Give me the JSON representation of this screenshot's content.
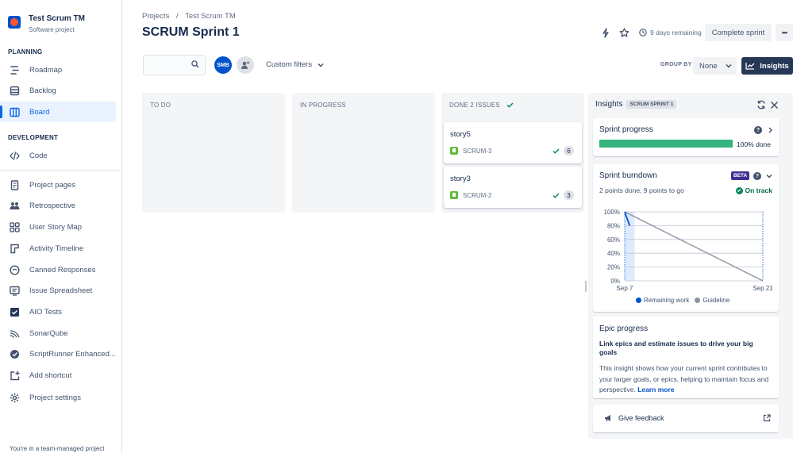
{
  "project": {
    "name": "Test Scrum TM",
    "type": "Software project"
  },
  "sidebar": {
    "planning_title": "PLANNING",
    "development_title": "DEVELOPMENT",
    "planning_items": [
      {
        "label": "Roadmap",
        "icon": "roadmap-icon"
      },
      {
        "label": "Backlog",
        "icon": "backlog-icon"
      },
      {
        "label": "Board",
        "icon": "board-icon",
        "active": true
      }
    ],
    "development_items": [
      {
        "label": "Code",
        "icon": "code-icon"
      }
    ],
    "apps": [
      {
        "label": "Project pages",
        "icon": "pages-icon"
      },
      {
        "label": "Retrospective",
        "icon": "retrospective-icon"
      },
      {
        "label": "User Story Map",
        "icon": "story-map-icon"
      },
      {
        "label": "Activity Timeline",
        "icon": "timeline-icon"
      },
      {
        "label": "Canned Responses",
        "icon": "canned-responses-icon"
      },
      {
        "label": "Issue Spreadsheet",
        "icon": "spreadsheet-icon"
      },
      {
        "label": "AIO Tests",
        "icon": "aio-tests-icon"
      },
      {
        "label": "SonarQube",
        "icon": "sonarqube-icon"
      },
      {
        "label": "ScriptRunner Enhanced...",
        "icon": "scriptrunner-icon"
      },
      {
        "label": "Add shortcut",
        "icon": "add-shortcut-icon"
      },
      {
        "label": "Project settings",
        "icon": "settings-icon"
      }
    ],
    "footer": "You're in a team-managed project"
  },
  "header": {
    "breadcrumb": [
      "Projects",
      "/",
      "Test Scrum TM"
    ],
    "title": "SCRUM Sprint 1",
    "days_remaining": "9 days remaining",
    "complete_sprint": "Complete sprint",
    "more": "•••"
  },
  "toolbar": {
    "search_placeholder": "",
    "avatar_initials": "SMB",
    "custom_filters": "Custom filters",
    "group_by_label": "GROUP BY",
    "group_by_value": "None",
    "insights_button": "Insights"
  },
  "columns": [
    {
      "title": "TO DO",
      "cards": []
    },
    {
      "title": "IN PROGRESS",
      "cards": []
    },
    {
      "title": "DONE 2 ISSUES",
      "cards": [
        {
          "title": "story5",
          "key": "SCRUM-3",
          "points": "6"
        },
        {
          "title": "story3",
          "key": "SCRUM-2",
          "points": "3"
        }
      ]
    }
  ],
  "insights": {
    "title": "Insights",
    "sprint_lozenge": "SCRUM SPRINT 1",
    "sprint_progress": {
      "title": "Sprint progress",
      "percent": 100,
      "label": "100% done"
    },
    "burndown": {
      "title": "Sprint burndown",
      "beta": "BETA",
      "subtitle": "2 points done, 9 points to go",
      "status": "On track",
      "legend_remaining": "Remaining work",
      "legend_guideline": "Guideline",
      "remaining_color": "#0052CC",
      "guideline_color": "#8993A4"
    },
    "epic": {
      "title": "Epic progress",
      "bold": "Link epics and estimate issues to drive your big goals",
      "text": "This insight shows how your current sprint contributes to your larger goals, or epics, helping to maintain focus and perspective.",
      "link": "Learn more"
    },
    "feedback": "Give feedback"
  },
  "chart_data": {
    "type": "line",
    "x_ticks": [
      "Sep 7",
      "Sep 21"
    ],
    "y_ticks": [
      "100%",
      "80%",
      "60%",
      "40%",
      "20%",
      "0%"
    ],
    "ylim": [
      0,
      100
    ],
    "series": [
      {
        "name": "Remaining work",
        "points": [
          [
            0,
            100
          ],
          [
            0.5,
            80
          ]
        ]
      },
      {
        "name": "Guideline",
        "points": [
          [
            0,
            100
          ],
          [
            14,
            0
          ]
        ]
      }
    ],
    "xlim": [
      0,
      14
    ]
  }
}
